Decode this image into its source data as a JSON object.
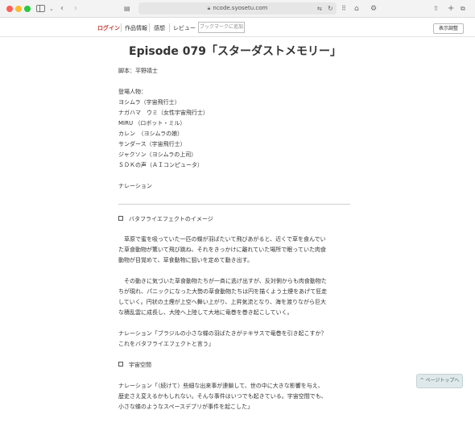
{
  "browser": {
    "url": "ncode.syosetu.com"
  },
  "nav": {
    "login": "ログイン",
    "work_info": "作品情報",
    "comments": "感想",
    "review": "レビュー",
    "bookmark": "ブックマークに追加",
    "display_settings": "表示調整"
  },
  "episode": {
    "title": "Episode 079「スターダストメモリー」",
    "writer": "脚本：平野靖士",
    "cast_heading": "登場人物：",
    "cast": [
      "ヨシムラ（宇宙飛行士）",
      "ナガハマ　ウミ（女性宇宙飛行士）",
      "MIRU （ロボット・ミル）",
      "カレン　（ヨシムラの娘）",
      "サンダース（宇宙飛行士）",
      "ジャクソン（ヨシムラの上司）",
      "ＳＤＫの声（ＡＩコンピュータ）"
    ],
    "narration_label": "ナレーション",
    "section1": "バタフライエフェクトのイメージ",
    "para1": [
      "　草原で蜜を吸っていた一匹の蝶が羽ばたいて飛びあがると、近くで草を食んでい",
      "た草食動物が驚いて飛び跳ね、それをきっかけに離れていた場所で眠っていた肉食",
      "動物が目覚めて、草食動物に狙いを定めて動き出す。"
    ],
    "para2": [
      "　その動きに気づいた草食動物たちが一斉に逃げ出すが、反対側からも肉食動物た",
      "ちが現れ、パニックになった大勢の草食動物たちは円を描くよう土煙をあげて狂走",
      "していく。円状の土煙が上空へ舞い上がり、上昇気流となり、海を渡りながら巨大",
      "な積乱雲に成長し、大陸へ上陸して大地に竜巻を巻き起こしていく。"
    ],
    "narration2": [
      "ナレーション「ブラジルの小さな蝶の羽ばたきがテキサスで竜巻を引き起こすか？",
      "これをバタフライエフェクトと言う」"
    ],
    "section2": "宇宙空間",
    "narration3": [
      "ナレーション「（続けて）些細な出来事が連鎖して、世の中に大きな影響を与え、",
      "歴史さえ変えるかもしれない。そんな事件はいつでも起きている。宇宙空間でも、",
      "小さな蝶のようなスペースデブリが事件を起こした」"
    ]
  },
  "page_top": "ページトップへ"
}
